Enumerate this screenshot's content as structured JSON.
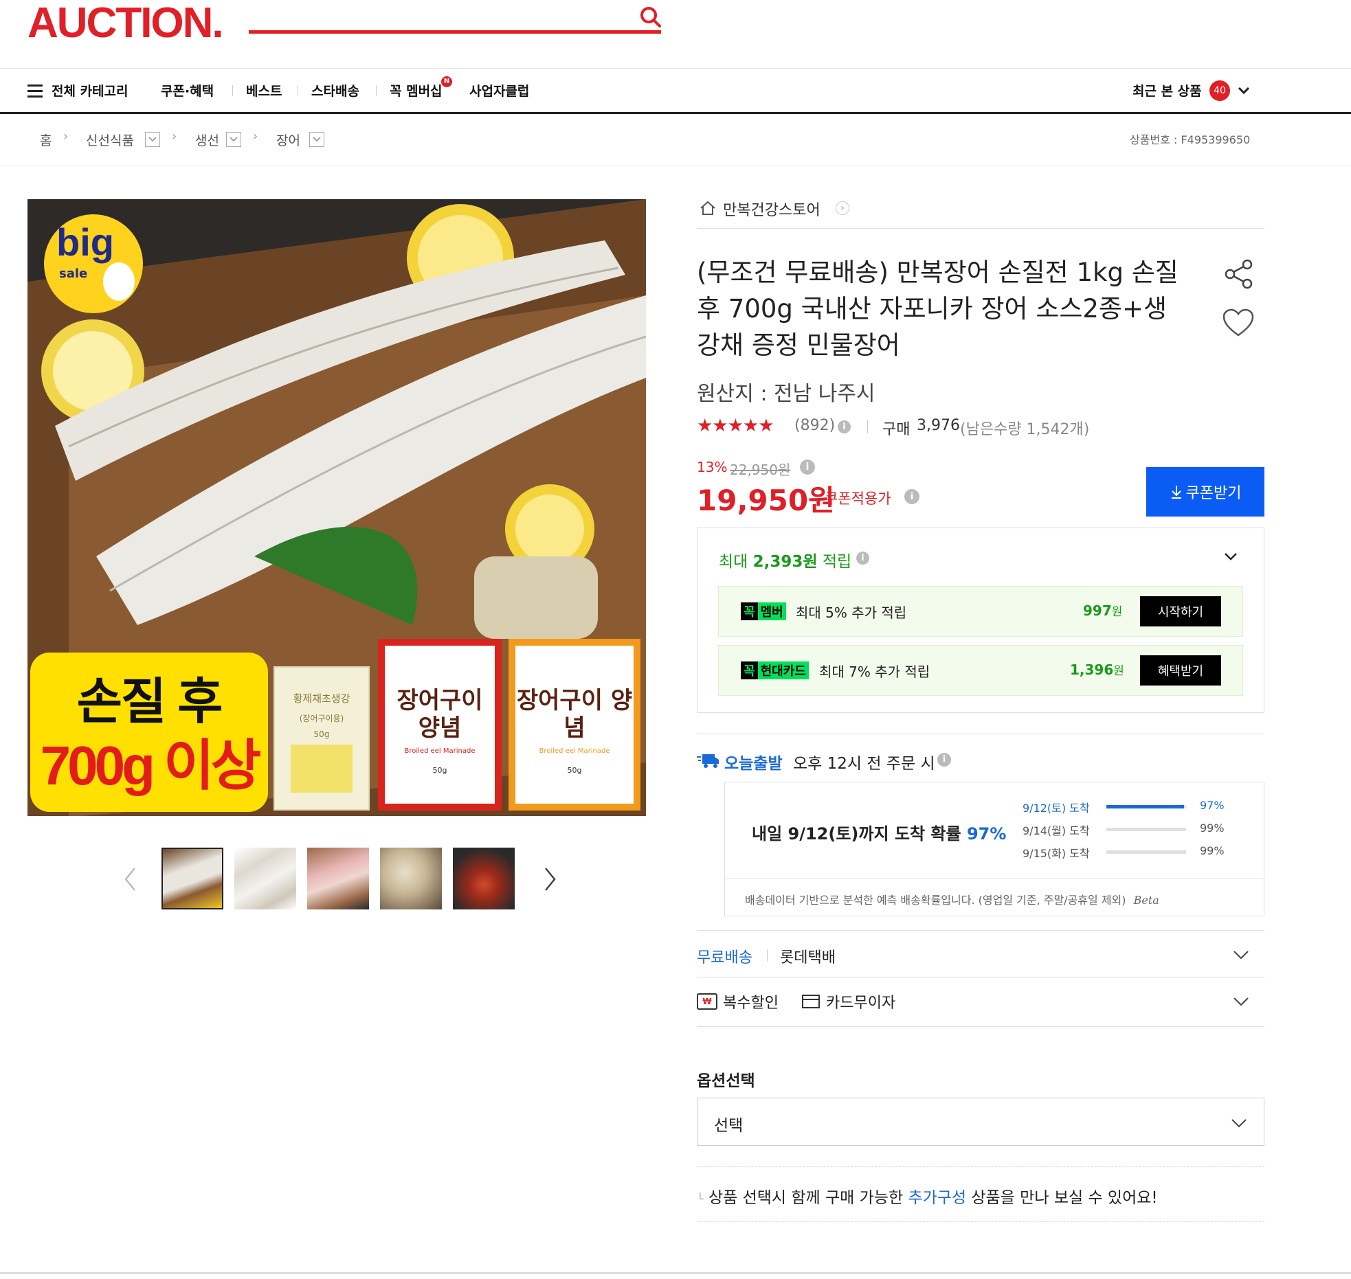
{
  "header": {
    "logo": "AUCTION."
  },
  "nav": {
    "all_categories": "전체 카테고리",
    "items": [
      "쿠폰·혜택",
      "베스트",
      "스타배송",
      "꼭 멤버십",
      "사업자클럽"
    ],
    "membership_badge": "N",
    "recent": "최근 본 상품",
    "recent_count": "40"
  },
  "breadcrumb": {
    "home": "홈",
    "items": [
      "신선식품",
      "생선",
      "장어"
    ],
    "product_no": "상품번호 : F495399650"
  },
  "image": {
    "badge_big": "big",
    "badge_sale": "sale",
    "promo_line1": "손질 후",
    "promo_line2": "700g 이상",
    "ginger_label": "황제채초생강",
    "ginger_sub": "(장어구이용)",
    "ginger_weight": "50g",
    "sauce_label": "장어구이 양념",
    "sauce_sub": "Broiled eel Marinade",
    "sauce_weight": "50g"
  },
  "product": {
    "store": "만복건강스토어",
    "title_lines": [
      "(무조건 무료배송) 만복장어 손질전 1kg 손질",
      "후 700g 국내산 자포니카 장어 소스2종+생",
      "강채 증정 민물장어"
    ],
    "origin": "원산지 : 전남 나주시",
    "rating": 4.5,
    "stars": "★★★★★",
    "review_count": "(892)",
    "purchase_label": "구매",
    "purchase_count": "3,976",
    "remaining": "(남은수량 1,542개)",
    "discount_rate": "13%",
    "original_price": "22,950원",
    "price": "19,950원",
    "price_note": "쿠폰적용가",
    "coupon_button": "쿠폰받기"
  },
  "points": {
    "label_prefix": "최대",
    "amount": "2,393원",
    "label_suffix": "적립",
    "rows": [
      {
        "badge_a": "꼭",
        "badge_b": "멤버",
        "text": "최대 5% 추가 적립",
        "amount": "997",
        "unit": "원",
        "button": "시작하기"
      },
      {
        "badge_a": "꼭",
        "badge_b": "현대카드",
        "text": "최대 7% 추가 적립",
        "amount": "1,396",
        "unit": "원",
        "button": "혜택받기"
      }
    ]
  },
  "delivery": {
    "today": "오늘출발",
    "condition": "오후 12시 전 주문 시",
    "summary_prefix": "내일 9/12(토)까지 도착 확률",
    "summary_pct": "97%",
    "rows": [
      {
        "date": "9/12(토) 도착",
        "pct": "97%",
        "fill": 0.97
      },
      {
        "date": "9/14(월) 도착",
        "pct": "99%",
        "fill": 0.0
      },
      {
        "date": "9/15(화) 도착",
        "pct": "99%",
        "fill": 0.0
      }
    ],
    "note": "배송데이터 기반으로 분석한 예측 배송확률입니다. (영업일 기준, 주말/공휴일 제외)",
    "beta": "Beta",
    "free_shipping": "무료배송",
    "carrier": "롯데택배",
    "multi_discount": "복수할인",
    "card_installment": "카드무이자"
  },
  "options": {
    "title": "옵션선택",
    "select_value": "선택",
    "info_prefix": "상품 선택시 함께 구매 가능한",
    "info_link": "추가구성",
    "info_suffix": "상품을 만나 보실 수 있어요!"
  },
  "colors": {
    "brand": "#e11f26",
    "blue": "#0a5cf5",
    "green": "#1a9a1a",
    "price_red": "#e11f26"
  }
}
